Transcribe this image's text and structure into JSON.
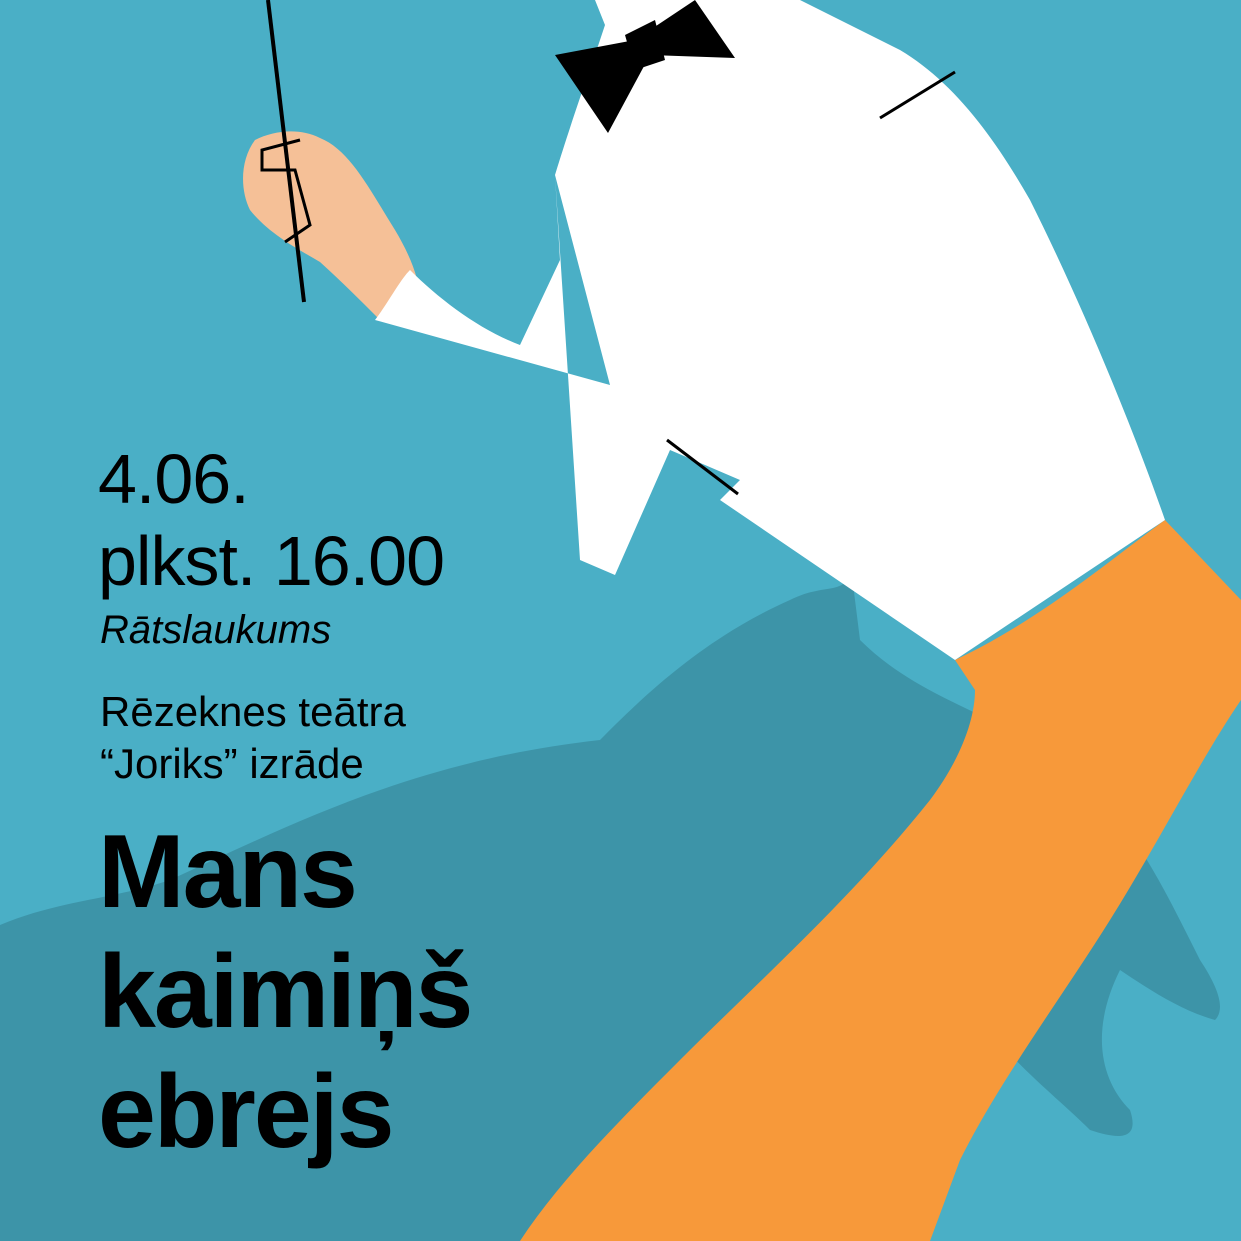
{
  "event": {
    "date": "4.06.",
    "time": "plkst. 16.00",
    "venue": "Rātslaukums",
    "subtitle_line1": "Rēzeknes teātra",
    "subtitle_line2": "“Joriks” izrāde",
    "title_line1": "Mans",
    "title_line2": "kaimiņš",
    "title_line3": "ebrejs"
  },
  "colors": {
    "background": "#4aafc6",
    "shadow": "#3d94a8",
    "shirt": "#ffffff",
    "trousers": "#f7993a",
    "skin": "#f5c097",
    "ink": "#000000"
  },
  "icons": {
    "figure": "dancing-man-illustration",
    "bow_tie": "bow-tie-icon",
    "baton": "conductor-baton"
  }
}
